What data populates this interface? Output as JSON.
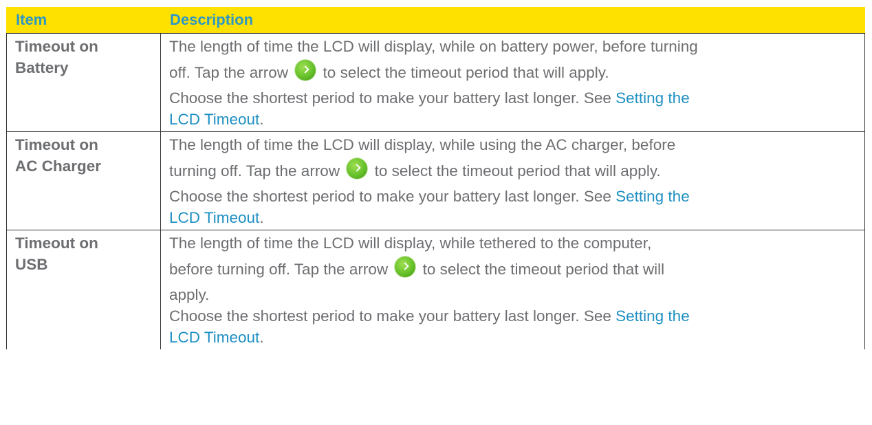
{
  "table": {
    "headers": {
      "item": "Item",
      "description": "Description"
    },
    "rows": [
      {
        "item_line1": "Timeout on",
        "item_line2": "Battery",
        "desc_line1": "The length of time the LCD will display, while on battery power, before turning",
        "desc_pre_arrow": "off. Tap the arrow",
        "desc_post_arrow": " to select the timeout period that will apply.",
        "desc_line3": "Choose the shortest period to make your battery last longer. See ",
        "link_line1": "Setting the",
        "link_line2": "LCD Timeout",
        "link_trail": "."
      },
      {
        "item_line1": "Timeout on",
        "item_line2": "AC Charger",
        "desc_line1": "The length of time the LCD will display, while using the AC charger, before",
        "desc_pre_arrow": "turning off. Tap the arrow",
        "desc_post_arrow": " to select the timeout period that will apply.",
        "desc_line3": "Choose the shortest period to make your battery last longer. See ",
        "link_line1": "Setting the",
        "link_line2": "LCD Timeout",
        "link_trail": "."
      },
      {
        "item_line1": "Timeout on",
        "item_line2": "USB",
        "desc_line1": "The length of time the LCD will display, while tethered to the computer,",
        "desc_pre_arrow": "before turning off. Tap the arrow",
        "desc_post_arrow": " to select the timeout period that will",
        "desc_extra": "apply.",
        "desc_line3": "Choose the shortest period to make your battery last longer. See ",
        "link_line1": "Setting the",
        "link_line2": "LCD Timeout",
        "link_trail": "."
      }
    ]
  },
  "icons": {
    "arrow": "green-circle-right-arrow-icon"
  },
  "colors": {
    "header_bg": "#ffe100",
    "header_text": "#2d97c4",
    "body_text": "#6d6e71",
    "link": "#1f90c3",
    "arrow_green": "#67c12a"
  }
}
